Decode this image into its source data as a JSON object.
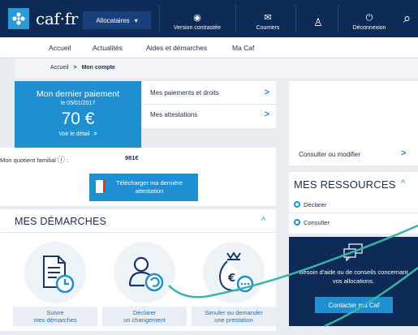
{
  "header": {
    "logo_text": "caf·fr",
    "allocataires_label": "Allocataires",
    "allocataires_caret": "▾",
    "items": [
      {
        "label": "Version contrastée",
        "icon": "eye-icon",
        "glyph": "◉"
      },
      {
        "label": "Courriers",
        "icon": "mail-icon",
        "glyph": "✉"
      },
      {
        "label": "",
        "icon": "user-icon",
        "glyph": "♙"
      },
      {
        "label": "Déconnexion",
        "icon": "power-icon",
        "glyph": "⏻"
      }
    ],
    "search_glyph": "⌕"
  },
  "nav": {
    "items": [
      "Accueil",
      "Actualités",
      "Aides et démarches",
      "Ma Caf"
    ]
  },
  "breadcrumb": {
    "home": "Accueil",
    "sep": ">",
    "current": "Mon compte"
  },
  "payment": {
    "title": "Mon dernier paiement",
    "date": "le 05/01/2017",
    "amount": "70 €",
    "detail_link": "Voir le détail",
    "detail_chevron": ">"
  },
  "payment_links": [
    {
      "label": "Mes paiements et droits",
      "chevron": ">"
    },
    {
      "label": "Mes attestations",
      "chevron": ">"
    }
  ],
  "quotient": {
    "label": "Mon quotient familial",
    "info_glyph": "ⓘ",
    "value": "981€"
  },
  "download_button": {
    "label_line1": "Télécharger ma dernière",
    "label_line2": "attestation"
  },
  "account": {
    "consult_label": "Consulter ou modifier",
    "chevron": ">"
  },
  "ressources": {
    "title": "MES RESSOURCES",
    "caret": "^",
    "items": [
      "Déclarer",
      "Consulter"
    ]
  },
  "help": {
    "text": "Besoin d'aide ou de conseils concernant vos allocations.",
    "button": "Contacter ma Caf"
  },
  "demarches": {
    "title": "MES DÉMARCHES",
    "caret": "^",
    "items": [
      {
        "line1": "Suivre",
        "line2": "mes démarches",
        "icon": "document-clock-icon"
      },
      {
        "line1": "Déclarer",
        "line2": "un changement",
        "icon": "user-refresh-icon"
      },
      {
        "line1": "Simuler ou demander",
        "line2": "une prestation",
        "icon": "money-bag-icon"
      }
    ]
  },
  "colors": {
    "navy": "#0e2a56",
    "accent_blue": "#1f8fd1",
    "annotation_teal": "#3bb3a8"
  }
}
